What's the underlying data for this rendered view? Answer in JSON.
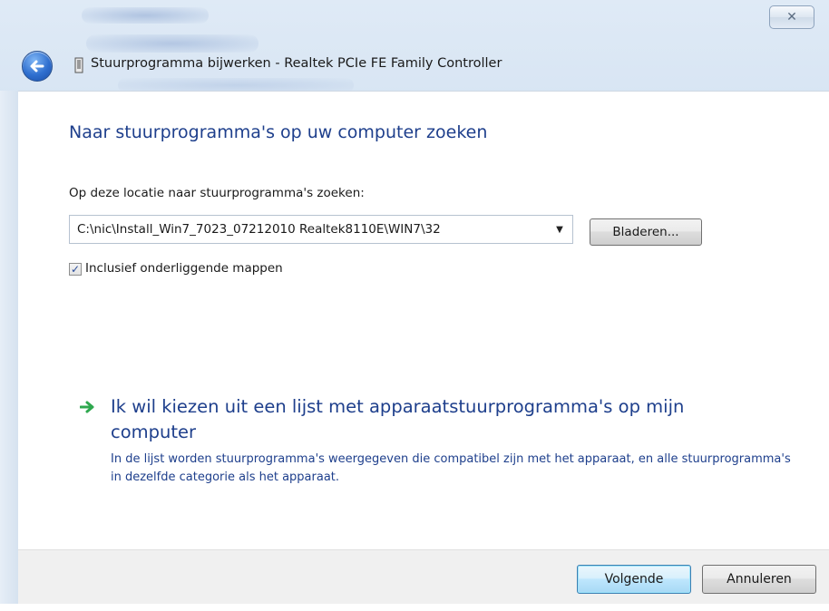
{
  "window": {
    "title": "Stuurprogramma bijwerken - Realtek PCIe FE Family Controller",
    "close_glyph": "✕",
    "back_icon": "back-arrow-icon",
    "device_icon": "device-icon"
  },
  "main": {
    "heading": "Naar stuurprogramma's op uw computer zoeken",
    "location_label": "Op deze locatie naar stuurprogramma's zoeken:",
    "path_value": "C:\\nic\\Install_Win7_7023_07212010 Realtek8110E\\WIN7\\32",
    "dropdown_glyph": "▼",
    "browse_label": "Bladeren...",
    "include_subfolders": {
      "checked": true,
      "check_glyph": "✓",
      "label": "Inclusief onderliggende mappen"
    },
    "command_link": {
      "icon": "green-arrow-icon",
      "title": "Ik wil kiezen uit een lijst met apparaatstuurprogramma's op mijn computer",
      "description": "In de lijst worden stuurprogramma's weergegeven die compatibel zijn met het apparaat, en alle stuurprogramma's in dezelfde categorie als het apparaat."
    }
  },
  "footer": {
    "next_label": "Volgende",
    "cancel_label": "Annuleren"
  },
  "colors": {
    "heading_blue": "#1e3f8c",
    "command_arrow_green": "#2fa84f",
    "frame_glass": "#cbdcee"
  }
}
